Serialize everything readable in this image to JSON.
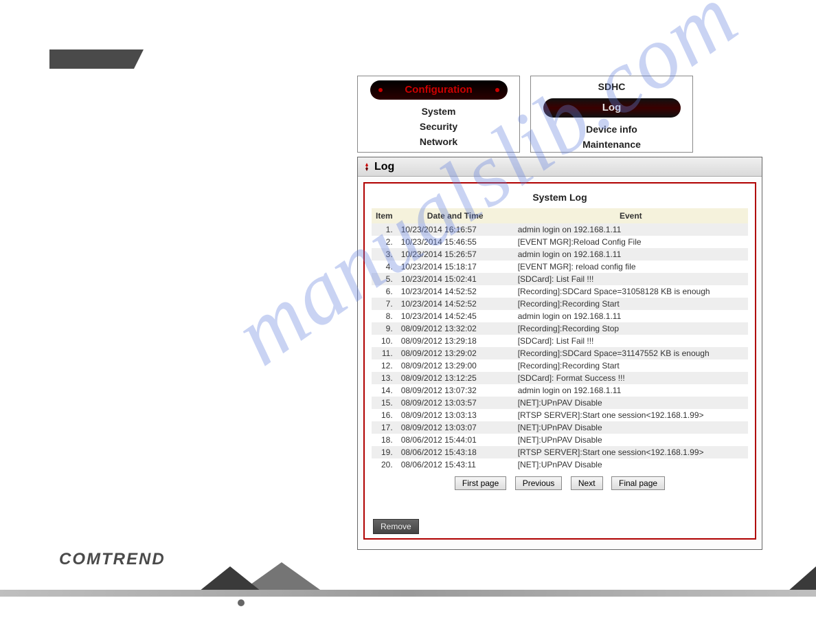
{
  "nav": {
    "left_pill": "Configuration",
    "left_items": [
      "System",
      "Security",
      "Network"
    ],
    "right_top": "SDHC",
    "right_pill": "Log",
    "right_items": [
      "Device info",
      "Maintenance"
    ]
  },
  "panel": {
    "title": "Log",
    "section_title": "System Log",
    "columns": {
      "item": "Item",
      "datetime": "Date and Time",
      "event": "Event"
    }
  },
  "rows": [
    {
      "n": "1.",
      "dt": "10/23/2014 16:16:57",
      "ev": "admin login on 192.168.1.11"
    },
    {
      "n": "2.",
      "dt": "10/23/2014 15:46:55",
      "ev": "[EVENT MGR]:Reload Config File"
    },
    {
      "n": "3.",
      "dt": "10/23/2014 15:26:57",
      "ev": "admin login on 192.168.1.11"
    },
    {
      "n": "4.",
      "dt": "10/23/2014 15:18:17",
      "ev": "[EVENT MGR]: reload config file"
    },
    {
      "n": "5.",
      "dt": "10/23/2014 15:02:41",
      "ev": "[SDCard]: List Fail !!!"
    },
    {
      "n": "6.",
      "dt": "10/23/2014 14:52:52",
      "ev": "[Recording]:SDCard Space=31058128 KB is enough"
    },
    {
      "n": "7.",
      "dt": "10/23/2014 14:52:52",
      "ev": "[Recording]:Recording Start"
    },
    {
      "n": "8.",
      "dt": "10/23/2014 14:52:45",
      "ev": "admin login on 192.168.1.11"
    },
    {
      "n": "9.",
      "dt": "08/09/2012 13:32:02",
      "ev": "[Recording]:Recording Stop"
    },
    {
      "n": "10.",
      "dt": "08/09/2012 13:29:18",
      "ev": "[SDCard]: List Fail !!!"
    },
    {
      "n": "11.",
      "dt": "08/09/2012 13:29:02",
      "ev": "[Recording]:SDCard Space=31147552 KB is enough"
    },
    {
      "n": "12.",
      "dt": "08/09/2012 13:29:00",
      "ev": "[Recording]:Recording Start"
    },
    {
      "n": "13.",
      "dt": "08/09/2012 13:12:25",
      "ev": "[SDCard]: Format Success !!!"
    },
    {
      "n": "14.",
      "dt": "08/09/2012 13:07:32",
      "ev": "admin login on 192.168.1.11"
    },
    {
      "n": "15.",
      "dt": "08/09/2012 13:03:57",
      "ev": "[NET]:UPnPAV Disable"
    },
    {
      "n": "16.",
      "dt": "08/09/2012 13:03:13",
      "ev": "[RTSP SERVER]:Start one session<192.168.1.99>"
    },
    {
      "n": "17.",
      "dt": "08/09/2012 13:03:07",
      "ev": "[NET]:UPnPAV Disable"
    },
    {
      "n": "18.",
      "dt": "08/06/2012 15:44:01",
      "ev": "[NET]:UPnPAV Disable"
    },
    {
      "n": "19.",
      "dt": "08/06/2012 15:43:18",
      "ev": "[RTSP SERVER]:Start one session<192.168.1.99>"
    },
    {
      "n": "20.",
      "dt": "08/06/2012 15:43:11",
      "ev": "[NET]:UPnPAV Disable"
    }
  ],
  "pager": {
    "first": "First page",
    "prev": "Previous",
    "next": "Next",
    "final": "Final page"
  },
  "buttons": {
    "remove": "Remove"
  },
  "brand": "COMTREND",
  "watermark": "manualslib.com"
}
